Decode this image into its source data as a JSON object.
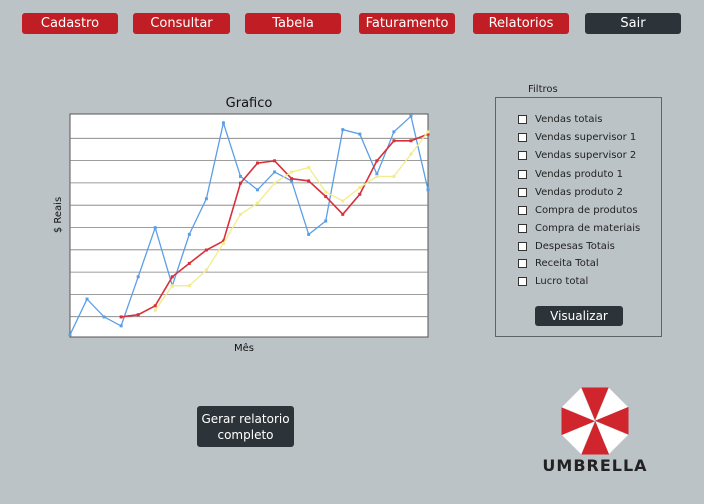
{
  "nav": {
    "items": [
      {
        "label": "Cadastro"
      },
      {
        "label": "Consultar"
      },
      {
        "label": "Tabela"
      },
      {
        "label": "Faturamento"
      },
      {
        "label": "Relatorios"
      },
      {
        "label": "Sair"
      }
    ]
  },
  "chart_data": {
    "type": "line",
    "title": "Grafico",
    "xlabel": "Mês",
    "ylabel": "$ Reais",
    "grid": true,
    "x": [
      1,
      2,
      3,
      4,
      5,
      6,
      7,
      8,
      9,
      10,
      11,
      12,
      13,
      14,
      15,
      16,
      17,
      18,
      19,
      20,
      21,
      22
    ],
    "ylim": [
      0,
      100
    ],
    "series": [
      {
        "color": "#5b9ee8",
        "x": [
          1,
          2,
          3,
          4,
          5,
          6,
          7,
          8,
          9,
          10,
          11,
          12,
          13,
          14,
          15,
          16,
          17,
          18,
          19,
          20,
          21,
          22
        ],
        "values": [
          1,
          17,
          9,
          5,
          27,
          49,
          23,
          46,
          62,
          96,
          72,
          66,
          74,
          70,
          46,
          52,
          93,
          91,
          73,
          92,
          99,
          66
        ]
      },
      {
        "color": "#d8303a",
        "x": [
          4,
          5,
          6,
          7,
          8,
          9,
          10,
          11,
          12,
          13,
          14,
          15,
          16,
          17,
          18,
          19,
          20,
          21,
          22
        ],
        "values": [
          9,
          10,
          14,
          27,
          33,
          39,
          43,
          69,
          78,
          79,
          71,
          70,
          63,
          55,
          64,
          79,
          88,
          88,
          91
        ]
      },
      {
        "color": "#f2ec8c",
        "x": [
          6,
          7,
          8,
          9,
          10,
          11,
          12,
          13,
          14,
          15,
          16,
          17,
          18,
          19,
          20,
          21,
          22
        ],
        "values": [
          12,
          23,
          23,
          30,
          42,
          55,
          60,
          69,
          74,
          76,
          65,
          61,
          67,
          72,
          72,
          82,
          92
        ]
      }
    ]
  },
  "filters": {
    "title": "Filtros",
    "items": [
      {
        "label": "Vendas totais"
      },
      {
        "label": "Vendas supervisor 1"
      },
      {
        "label": "Vendas supervisor 2"
      },
      {
        "label": "Vendas produto 1"
      },
      {
        "label": "Vendas produto 2"
      },
      {
        "label": "Compra de produtos"
      },
      {
        "label": "Compra de materiais"
      },
      {
        "label": "Despesas Totais"
      },
      {
        "label": "Receita Total"
      },
      {
        "label": "Lucro total"
      }
    ],
    "button_label": "Visualizar"
  },
  "report_button": {
    "line1": "Gerar relatorio",
    "line2": "completo"
  },
  "logo": {
    "text": "UMBRELLA",
    "colors": {
      "red": "#d0252c",
      "white": "#ffffff"
    }
  }
}
